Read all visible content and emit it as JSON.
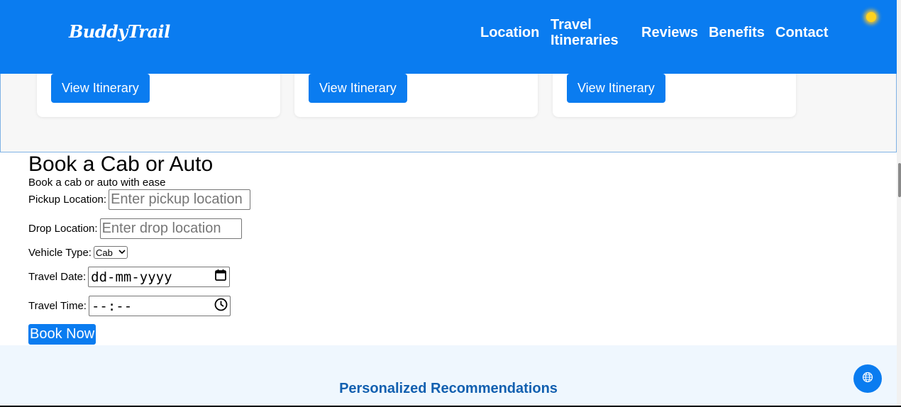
{
  "header": {
    "logo": "BuddyTrail",
    "nav": [
      {
        "label": "Location"
      },
      {
        "label": "Travel Itineraries"
      },
      {
        "label": "Reviews"
      },
      {
        "label": "Benefits"
      },
      {
        "label": "Contact"
      }
    ],
    "theme_icon": "sun-icon"
  },
  "itineraries": {
    "cards": [
      {
        "button": "View Itinerary"
      },
      {
        "button": "View Itinerary"
      },
      {
        "button": "View Itinerary"
      }
    ]
  },
  "booking": {
    "title": "Book a Cab or Auto",
    "subtitle": "Book a cab or auto with ease",
    "pickup": {
      "label": "Pickup Location:",
      "placeholder": "Enter pickup location"
    },
    "drop": {
      "label": "Drop Location:",
      "placeholder": "Enter drop location"
    },
    "vehicle": {
      "label": "Vehicle Type:",
      "selected": "Cab"
    },
    "date": {
      "label": "Travel Date:",
      "value": "dd-mm-yyyy"
    },
    "time": {
      "label": "Travel Time:",
      "value": "--:--"
    },
    "submit": "Book Now"
  },
  "recommendations": {
    "title": "Personalized Recommendations"
  },
  "colors": {
    "brand": "#0a7cf0",
    "reco_title": "#1260b0"
  },
  "floating": {
    "icon": "globe-icon"
  }
}
